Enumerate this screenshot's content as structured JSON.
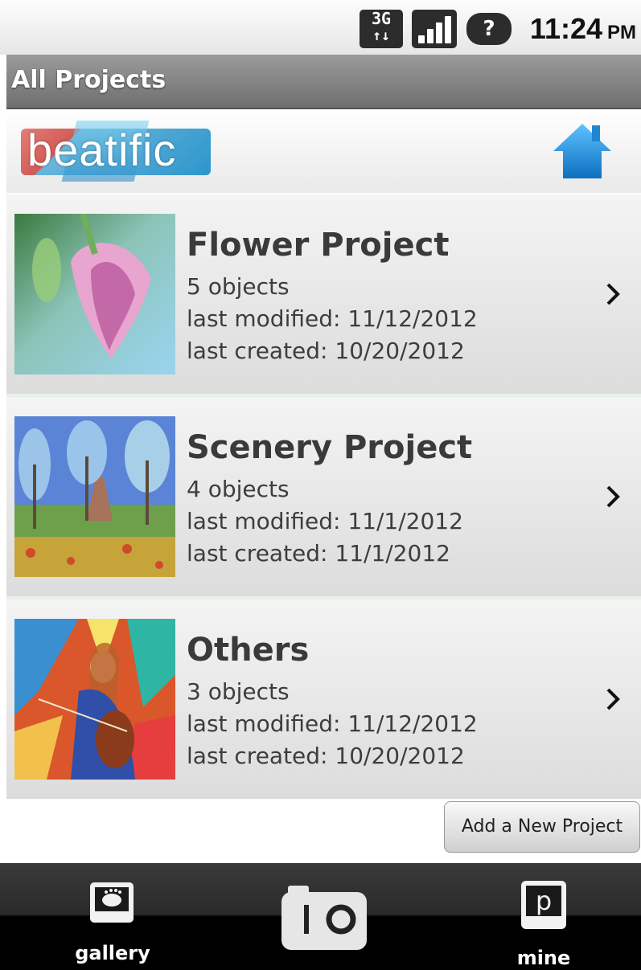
{
  "status_bar": {
    "network": "3G",
    "network_arrows": "↑↓",
    "help_glyph": "?",
    "time": "11:24",
    "ampm": "PM",
    "icons": [
      "3g-icon",
      "signal-icon",
      "help-icon"
    ]
  },
  "title_bar": {
    "title": "All Projects"
  },
  "header": {
    "logo_text": "beatific",
    "home_icon": "home-icon"
  },
  "projects": [
    {
      "title": "Flower Project",
      "count": "5 objects",
      "modified": "last modified: 11/12/2012",
      "created": "last created: 10/20/2012"
    },
    {
      "title": "Scenery Project",
      "count": "4 objects",
      "modified": "last modified: 11/1/2012",
      "created": "last created: 11/1/2012"
    },
    {
      "title": "Others",
      "count": "3 objects",
      "modified": "last modified: 11/12/2012",
      "created": "last created: 10/20/2012"
    }
  ],
  "add_button": {
    "label": "Add a New Project"
  },
  "bottom_bar": {
    "tabs": [
      {
        "label": "gallery",
        "icon": "gallery-icon"
      },
      {
        "label": "",
        "icon": "camera-icon"
      },
      {
        "label": "mine",
        "icon": "mine-icon"
      }
    ],
    "mine_glyph": "p"
  },
  "colors": {
    "title_bar": "#808080",
    "accent_blue": "#1e8fd6",
    "bottom_bar": "#000000"
  }
}
